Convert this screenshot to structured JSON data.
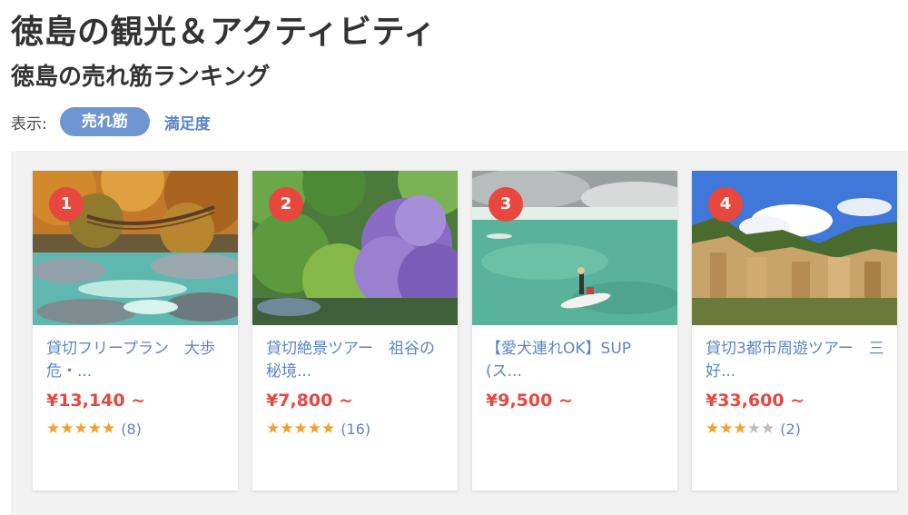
{
  "page": {
    "title": "徳島の観光＆アクティビティ",
    "section_title": "徳島の売れ筋ランキング"
  },
  "sort": {
    "label": "表示:",
    "active": "売れ筋",
    "other": "満足度"
  },
  "colors": {
    "accent_blue": "#6f96d1",
    "link_blue": "#5b85c9",
    "price_red": "#e8473e",
    "star_orange": "#f0a030",
    "panel_bg": "#f2f2f2"
  },
  "cards": [
    {
      "rank": "1",
      "title": "貸切フリープラン　大歩危・...",
      "price": "¥13,140 ~",
      "rating": 5,
      "review_count": "(8)",
      "image": "autumn-river-vine-bridge-photo"
    },
    {
      "rank": "2",
      "title": "貸切絶景ツアー　祖谷の秘境...",
      "price": "¥7,800 ~",
      "rating": 5,
      "review_count": "(16)",
      "image": "wisteria-gorge-photo"
    },
    {
      "rank": "3",
      "title": "【愛犬連れOK】SUP(ス...",
      "price": "¥9,500 ~",
      "rating": null,
      "review_count": "",
      "image": "river-sup-paddleboard-photo"
    },
    {
      "rank": "4",
      "title": "貸切3都市周遊ツアー　三好...",
      "price": "¥33,600 ~",
      "rating": 3,
      "review_count": "(2)",
      "image": "earth-pillars-cliff-photo"
    }
  ]
}
